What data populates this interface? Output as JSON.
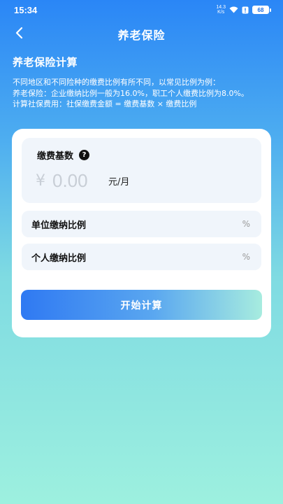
{
  "status_bar": {
    "time": "15:34",
    "net_speed_value": "14.3",
    "net_speed_unit": "K/s",
    "battery": "68"
  },
  "nav": {
    "title": "养老保险"
  },
  "section": {
    "title": "养老保险计算",
    "desc_line1": "不同地区和不同险种的缴费比例有所不同，以常见比例为例：",
    "desc_line2": "养老保险：企业缴纳比例一般为16.0%，职工个人缴费比例为8.0%。",
    "desc_line3": "计算社保费用：社保缴费金额 = 缴费基数 × 缴费比例"
  },
  "form": {
    "base_label": "缴费基数",
    "help_symbol": "?",
    "currency_symbol": "¥",
    "base_placeholder": "0.00",
    "base_unit": "元/月",
    "company_ratio_label": "单位缴纳比例",
    "company_ratio_unit": "%",
    "personal_ratio_label": "个人缴纳比例",
    "personal_ratio_unit": "%",
    "calc_button": "开始计算"
  },
  "colors": {
    "bg_top": "#2a86f6",
    "bg_bottom": "#9df0df",
    "button_start": "#2f79f2",
    "button_end": "#a7ecdf",
    "field_bg": "#f0f5fb"
  }
}
